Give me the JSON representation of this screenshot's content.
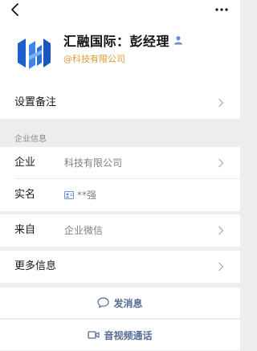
{
  "profile": {
    "name": "汇融国际：彭经理",
    "company_tag": "@科技有限公司"
  },
  "rows": {
    "remark": {
      "label": "设置备注"
    },
    "enterprise_section": "企业信息",
    "enterprise": {
      "label": "企业",
      "value": "科技有限公司"
    },
    "realname": {
      "label": "实名",
      "value": "**强"
    },
    "source": {
      "label": "来自",
      "value": "企业微信"
    },
    "more_info": {
      "label": "更多信息"
    }
  },
  "actions": {
    "send_message": "发消息",
    "av_call": "音视频通话"
  },
  "icons": {
    "back": "back-chevron-icon",
    "more": "more-dots-icon",
    "logo": "company-logo",
    "person": "person-icon",
    "idcard": "id-card-icon",
    "chat": "chat-bubble-icon",
    "video": "video-camera-icon"
  },
  "colors": {
    "accent_link": "#576b95",
    "company_tag": "#e09a37",
    "logo_blue": "#2d6bd1",
    "background": "#ededed"
  }
}
